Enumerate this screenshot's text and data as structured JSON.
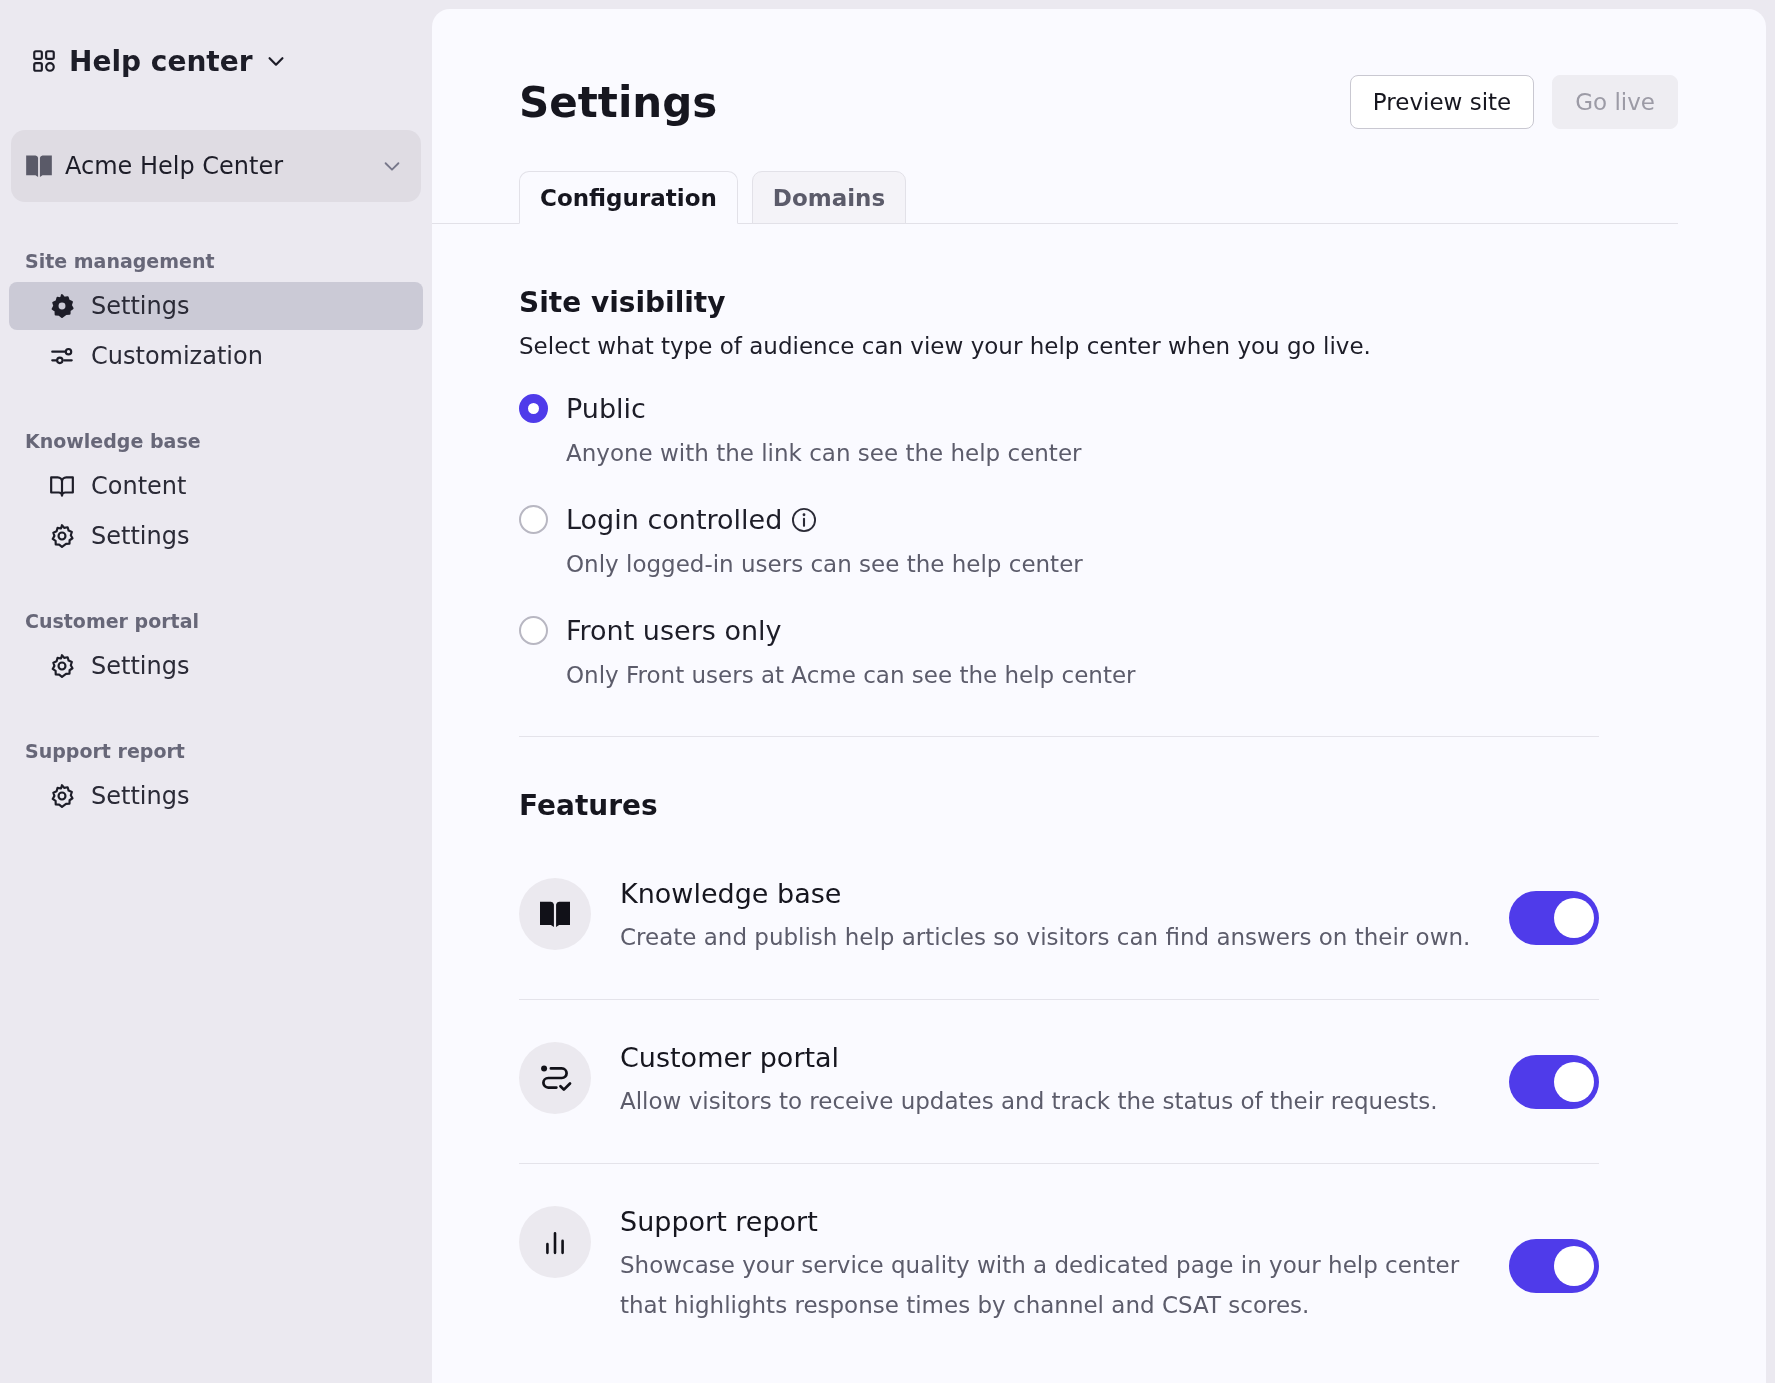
{
  "sidebar": {
    "app_title": "Help center",
    "site_selector": {
      "label": "Acme Help Center"
    },
    "sections": [
      {
        "title": "Site management",
        "items": [
          {
            "label": "Settings",
            "kind": "settings",
            "selected": true
          },
          {
            "label": "Customization",
            "kind": "customization",
            "selected": false
          }
        ]
      },
      {
        "title": "Knowledge base",
        "items": [
          {
            "label": "Content",
            "kind": "content",
            "selected": false
          },
          {
            "label": "Settings",
            "kind": "settings",
            "selected": false
          }
        ]
      },
      {
        "title": "Customer portal",
        "items": [
          {
            "label": "Settings",
            "kind": "settings",
            "selected": false
          }
        ]
      },
      {
        "title": "Support report",
        "items": [
          {
            "label": "Settings",
            "kind": "settings",
            "selected": false
          }
        ]
      }
    ]
  },
  "header": {
    "title": "Settings",
    "buttons": [
      {
        "label": "Preview site",
        "disabled": false
      },
      {
        "label": "Go live",
        "disabled": true
      }
    ]
  },
  "tabs": [
    {
      "label": "Configuration",
      "selected": true
    },
    {
      "label": "Domains",
      "selected": false
    }
  ],
  "site_visibility": {
    "title": "Site visibility",
    "description": "Select what type of audience can view your help center when you go live.",
    "options": [
      {
        "label": "Public",
        "description": "Anyone with the link can see the help center",
        "selected": true,
        "info": false
      },
      {
        "label": "Login controlled",
        "description": "Only logged-in users can see the help center",
        "selected": false,
        "info": true
      },
      {
        "label": "Front users only",
        "description": "Only Front users at Acme can see the help center",
        "selected": false,
        "info": false
      }
    ]
  },
  "features": {
    "title": "Features",
    "items": [
      {
        "kind": "book",
        "title": "Knowledge base",
        "description": "Create and publish help articles so visitors can find answers on their own.",
        "on": true
      },
      {
        "kind": "portal",
        "title": "Customer portal",
        "description": "Allow visitors to receive updates and track the status of their requests.",
        "on": true
      },
      {
        "kind": "chart",
        "title": "Support report",
        "description": "Showcase your service quality with a dedicated page in your help center that highlights response times by channel and CSAT scores.",
        "on": true
      }
    ]
  }
}
